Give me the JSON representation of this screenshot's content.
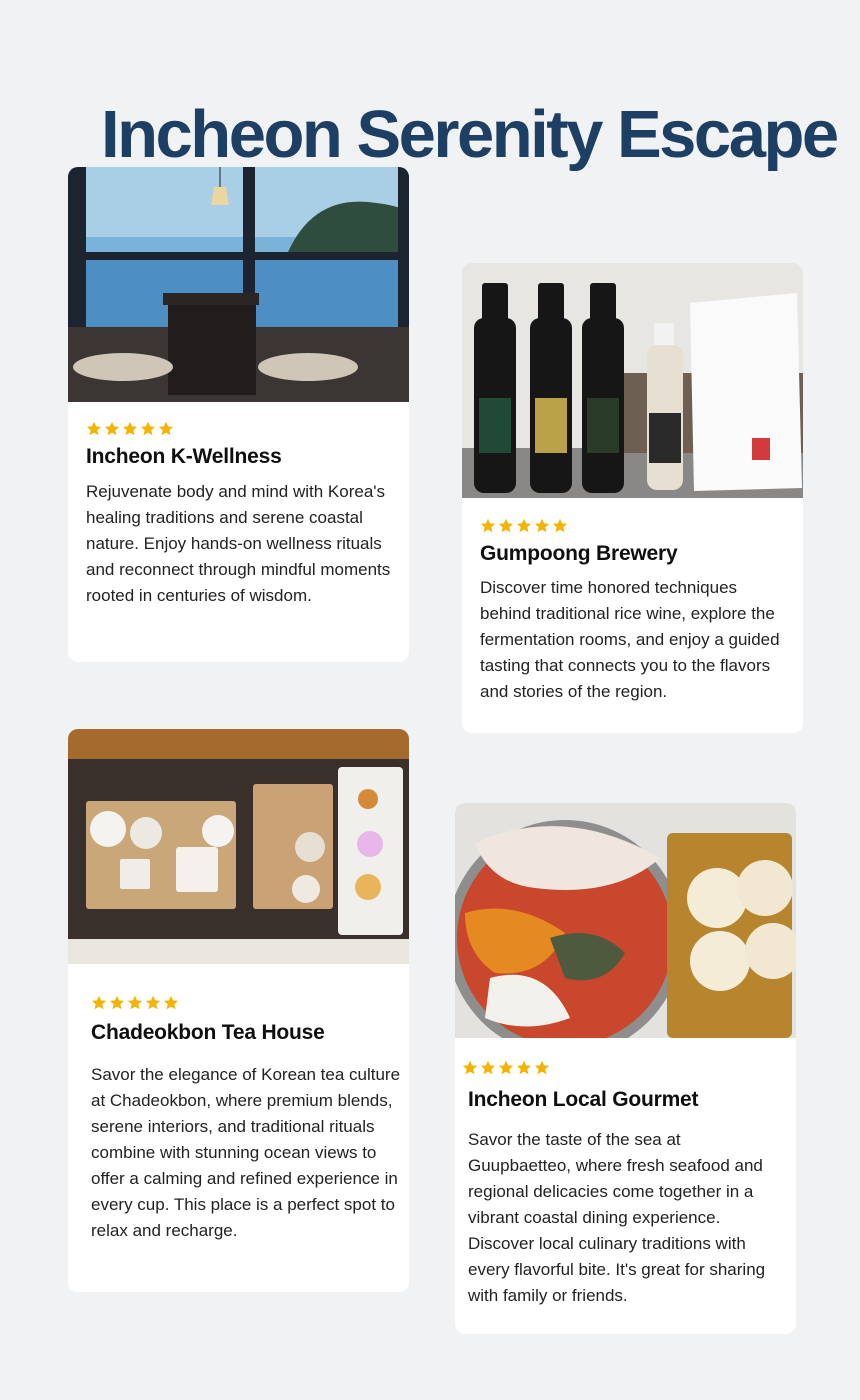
{
  "page": {
    "title": "Incheon Serenity Escape"
  },
  "cards": [
    {
      "rating": 5,
      "rating_icon": "star-icon",
      "title": "Incheon K-Wellness",
      "description": "Rejuvenate body and mind with Korea's healing traditions and serene coastal nature. Enjoy hands-on wellness rituals and reconnect through mindful moments rooted in centuries of wisdom.",
      "image": "ocean-view-room-photo"
    },
    {
      "rating": 5,
      "rating_icon": "star-icon",
      "title": "Gumpoong Brewery",
      "description": "Discover time honored techniques behind traditional rice wine, explore the fermentation rooms, and enjoy a guided tasting that connects you to the flavors and stories of the region.",
      "image": "rice-wine-bottles-photo"
    },
    {
      "rating": 5,
      "rating_icon": "star-icon",
      "title": "Chadeokbon Tea House",
      "description": "Savor the elegance of Korean tea culture at Chadeokbon, where premium blends, serene interiors, and traditional rituals combine with stunning ocean views to offer a calming and refined experience in every cup. This place is a perfect spot to relax and recharge.",
      "image": "tea-set-photo"
    },
    {
      "rating": 5,
      "rating_icon": "star-icon",
      "title": "Incheon Local Gourmet",
      "description": "Savor the taste of the sea at Guupbaetteo, where fresh seafood and regional delicacies come together in a vibrant coastal dining experience. Discover local culinary traditions with every flavorful bite. It's great for sharing with family or friends.",
      "image": "seafood-hotpot-photo"
    }
  ],
  "colors": {
    "title": "#1c3f63",
    "star": "#f5b301",
    "background": "#f1f2f4",
    "card": "#ffffff"
  }
}
